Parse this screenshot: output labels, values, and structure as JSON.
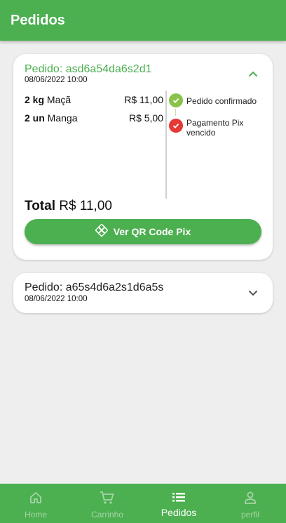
{
  "appbar": {
    "title": "Pedidos"
  },
  "orders": [
    {
      "label": "Pedido: asd6a54da6s2d1",
      "date": "08/06/2022 10:00",
      "items": [
        {
          "qty": "2 kg",
          "name": "Maçã",
          "price": "R$ 11,00"
        },
        {
          "qty": "2 un",
          "name": "Manga",
          "price": "R$ 5,00"
        }
      ],
      "statuses": [
        {
          "text": "Pedido confirmado",
          "state": "done"
        },
        {
          "text": "Pagamento Pix vencido",
          "state": "error"
        }
      ],
      "total_label": "Total",
      "total_value": "R$ 11,00",
      "button_label": "Ver QR Code Pix",
      "expanded": true
    },
    {
      "label": "Pedido: a65s4d6a2s1d6a5s",
      "date": "08/06/2022 10:00",
      "expanded": false
    }
  ],
  "bottom_nav": [
    {
      "label": "Home",
      "icon": "home-icon",
      "active": false
    },
    {
      "label": "Carrinho",
      "icon": "cart-icon",
      "active": false
    },
    {
      "label": "Pedidos",
      "icon": "list-icon",
      "active": true
    },
    {
      "label": "perfil",
      "icon": "person-icon",
      "active": false
    }
  ],
  "colors": {
    "primary": "#4caf50",
    "success": "#8bc34a",
    "error": "#e53935",
    "background": "#eeeeee"
  }
}
